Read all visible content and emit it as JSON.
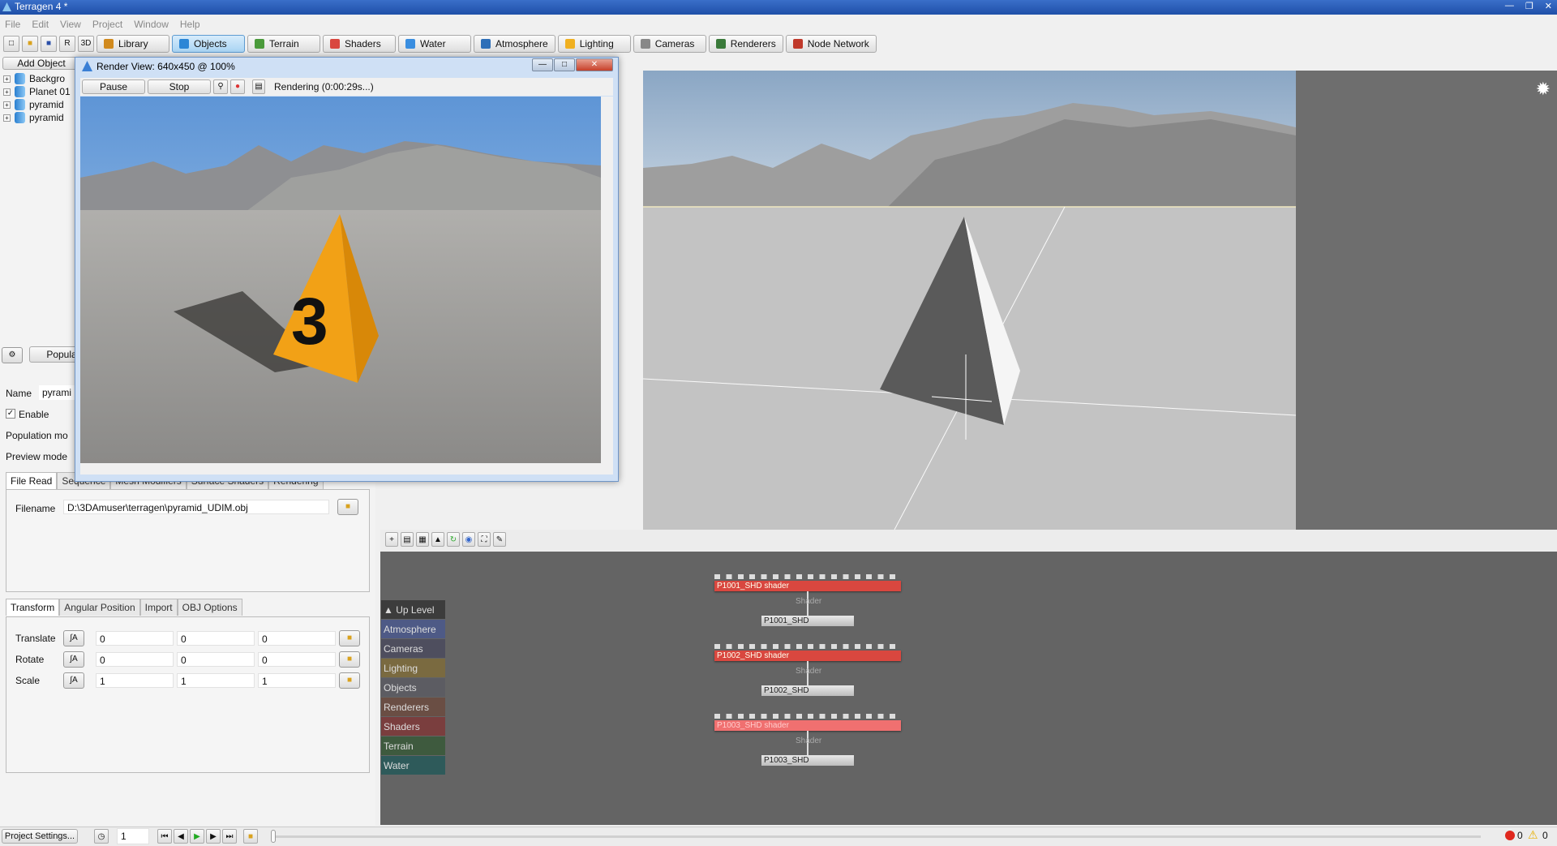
{
  "app": {
    "title": "Terragen 4 *"
  },
  "menu": [
    "File",
    "Edit",
    "View",
    "Project",
    "Window",
    "Help"
  ],
  "toolbar": {
    "buttons": [
      {
        "label": "Library",
        "color": "#d18a1e"
      },
      {
        "label": "Objects",
        "color": "#2b86d6",
        "active": true
      },
      {
        "label": "Terrain",
        "color": "#4a9a3a"
      },
      {
        "label": "Shaders",
        "color": "#d9473f"
      },
      {
        "label": "Water",
        "color": "#3a8ee0"
      },
      {
        "label": "Atmosphere",
        "color": "#2e6fb8"
      },
      {
        "label": "Lighting",
        "color": "#f0b020"
      },
      {
        "label": "Cameras",
        "color": "#888888"
      },
      {
        "label": "Renderers",
        "color": "#3a7a3a"
      },
      {
        "label": "Node Network",
        "color": "#c0392b"
      }
    ]
  },
  "left": {
    "add_object": "Add Object",
    "tree": [
      "Backgro",
      "Planet 01",
      "pyramid",
      "pyramid"
    ],
    "populate": "Populate",
    "name_label": "Name",
    "name_value": "pyrami",
    "enable_label": "Enable",
    "enable_checked": true,
    "population_mode": "Population mo",
    "preview_mode": "Preview mode",
    "tabs": [
      "File Read",
      "Sequence",
      "Mesh Modifiers",
      "Surface Shaders",
      "Rendering"
    ],
    "filename_label": "Filename",
    "filename_value": "D:\\3DAmuser\\terragen\\pyramid_UDIM.obj",
    "transform_tabs": [
      "Transform",
      "Angular Position",
      "Import",
      "OBJ Options"
    ],
    "rows": [
      {
        "label": "Translate",
        "values": [
          "0",
          "0",
          "0"
        ]
      },
      {
        "label": "Rotate",
        "values": [
          "0",
          "0",
          "0"
        ]
      },
      {
        "label": "Scale",
        "values": [
          "1",
          "1",
          "1"
        ]
      }
    ]
  },
  "render_view": {
    "title": "Render View: 640x450 @ 100%",
    "pause": "Pause",
    "stop": "Stop",
    "status": "Rendering  (0:00:29s...)",
    "marker": "3"
  },
  "node_network": {
    "categories": [
      {
        "label": "Up Level",
        "color": "#3c3c3c"
      },
      {
        "label": "Atmosphere",
        "color": "#4e5a86"
      },
      {
        "label": "Cameras",
        "color": "#4e4e5e"
      },
      {
        "label": "Lighting",
        "color": "#7a6a40"
      },
      {
        "label": "Objects",
        "color": "#5c5c62"
      },
      {
        "label": "Renderers",
        "color": "#6a4e44"
      },
      {
        "label": "Shaders",
        "color": "#7a3e3e"
      },
      {
        "label": "Terrain",
        "color": "#3e5a3e"
      },
      {
        "label": "Water",
        "color": "#2e5a5a"
      }
    ],
    "nodes": [
      {
        "shader": "P1001_SHD shader",
        "link": "Shader",
        "object": "P1001_SHD"
      },
      {
        "shader": "P1002_SHD shader",
        "link": "Shader",
        "object": "P1002_SHD"
      },
      {
        "shader": "P1003_SHD shader",
        "link": "Shader",
        "object": "P1003_SHD",
        "highlighted": true
      }
    ]
  },
  "bottom": {
    "project_settings": "Project Settings...",
    "frame": "1",
    "errors": "0",
    "warnings": "0"
  }
}
